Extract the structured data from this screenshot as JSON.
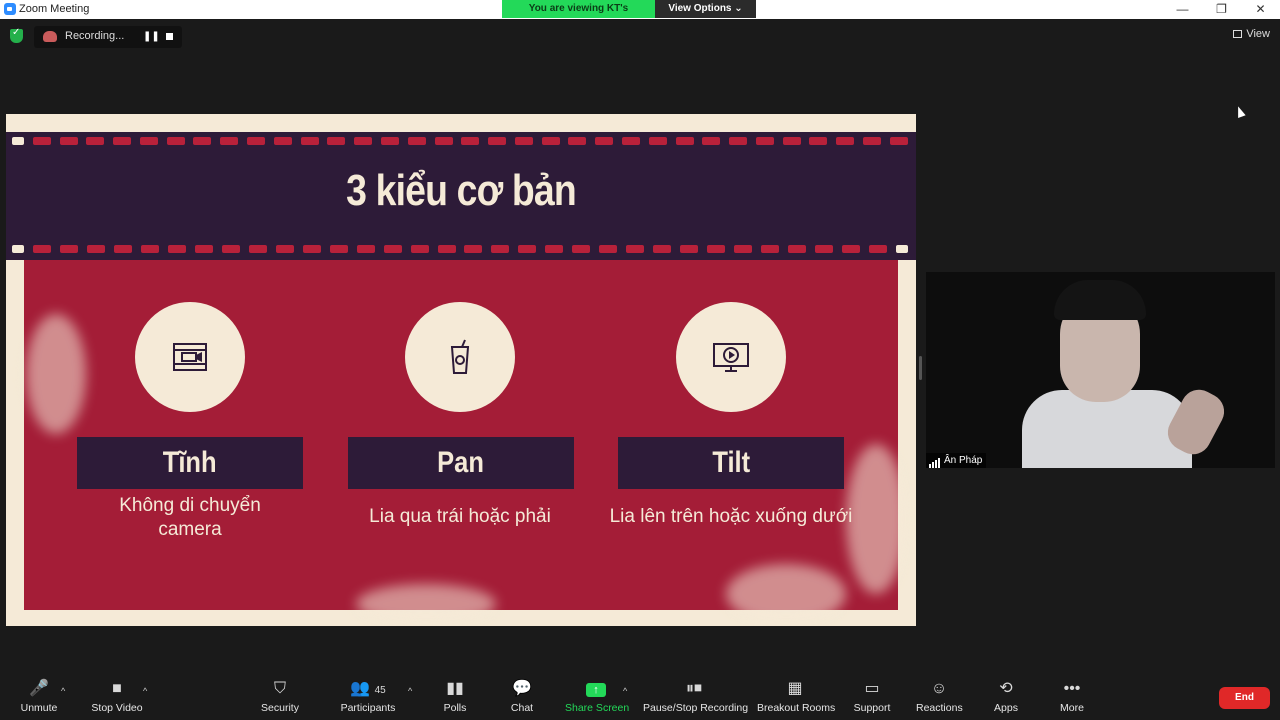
{
  "window": {
    "title": "Zoom Meeting"
  },
  "banner": {
    "viewing": "You are viewing KT's screen",
    "options": "View Options"
  },
  "window_controls": {
    "minimize": "—",
    "restore": "❐",
    "close": "✕"
  },
  "recording": {
    "status": "Recording...",
    "pause": "❚❚"
  },
  "view": {
    "label": "View"
  },
  "slide": {
    "title": "3 kiểu cơ bản",
    "items": [
      {
        "heading": "Tĩnh",
        "description": "Không di chuyển camera",
        "icon": "film-camera-icon"
      },
      {
        "heading": "Pan",
        "description": "Lia qua trái hoặc phải",
        "icon": "cup-icon"
      },
      {
        "heading": "Tilt",
        "description": "Lia lên trên hoặc xuống dưới",
        "icon": "play-monitor-icon"
      }
    ]
  },
  "participant": {
    "name": "Ân Pháp"
  },
  "toolbar": {
    "unmute": "Unmute",
    "stop_video": "Stop Video",
    "security": "Security",
    "participants": "Participants",
    "participant_count": "45",
    "polls": "Polls",
    "chat": "Chat",
    "share_screen": "Share Screen",
    "pause_stop_recording": "Pause/Stop Recording",
    "breakout_rooms": "Breakout Rooms",
    "support": "Support",
    "reactions": "Reactions",
    "apps": "Apps",
    "more": "More",
    "end": "End"
  },
  "colors": {
    "share_green": "#23d959",
    "end_red": "#e02828",
    "slide_red": "#a41d37",
    "slide_purple": "#2d1b38",
    "cream": "#f5ead7"
  }
}
